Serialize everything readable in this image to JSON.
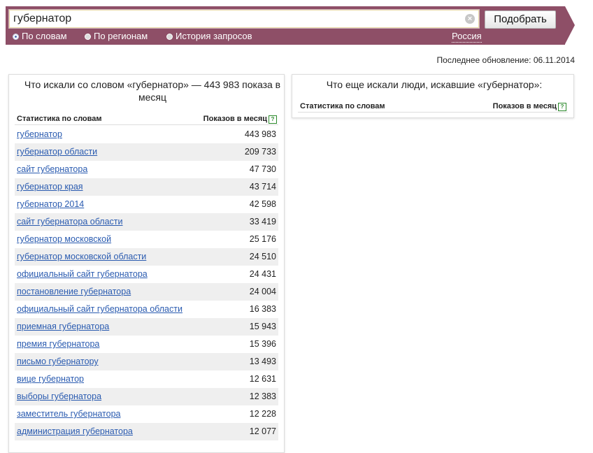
{
  "search": {
    "query": "губернатор",
    "submit_label": "Подобрать",
    "clear_symbol": "×"
  },
  "tabs": [
    {
      "label": "По словам",
      "selected": true
    },
    {
      "label": "По регионам",
      "selected": false
    },
    {
      "label": "История запросов",
      "selected": false
    }
  ],
  "region": "Россия",
  "last_update": "Последнее обновление: 06.11.2014",
  "left_panel": {
    "title": "Что искали со словом «губернатор» — 443 983 показа в месяц",
    "col_words": "Статистика по словам",
    "col_count": "Показов в месяц",
    "help_symbol": "?",
    "rows": [
      {
        "phrase": "губернатор",
        "count": "443 983"
      },
      {
        "phrase": "губернатор области",
        "count": "209 733"
      },
      {
        "phrase": "сайт губернатора",
        "count": "47 730"
      },
      {
        "phrase": "губернатор края",
        "count": "43 714"
      },
      {
        "phrase": "губернатор 2014",
        "count": "42 598"
      },
      {
        "phrase": "сайт губернатора области",
        "count": "33 419"
      },
      {
        "phrase": "губернатор московской",
        "count": "25 176"
      },
      {
        "phrase": "губернатор московской области",
        "count": "24 510"
      },
      {
        "phrase": "официальный сайт губернатора",
        "count": "24 431"
      },
      {
        "phrase": "постановление губернатора",
        "count": "24 004"
      },
      {
        "phrase": "официальный сайт губернатора области",
        "count": "16 383"
      },
      {
        "phrase": "приемная губернатора",
        "count": "15 943"
      },
      {
        "phrase": "премия губернатора",
        "count": "15 396"
      },
      {
        "phrase": "письмо губернатору",
        "count": "13 493"
      },
      {
        "phrase": "вице губернатор",
        "count": "12 631"
      },
      {
        "phrase": "выборы губернатора",
        "count": "12 383"
      },
      {
        "phrase": "заместитель губернатора",
        "count": "12 228"
      },
      {
        "phrase": "администрация губернатора",
        "count": "12 077"
      }
    ]
  },
  "right_panel": {
    "title": "Что еще искали люди, искавшие «губернатор»:",
    "col_words": "Статистика по словам",
    "col_count": "Показов в месяц",
    "help_symbol": "?"
  },
  "colors": {
    "header_bg": "#8e4f67",
    "link": "#2a5bb0",
    "alt_row": "#efefef"
  }
}
